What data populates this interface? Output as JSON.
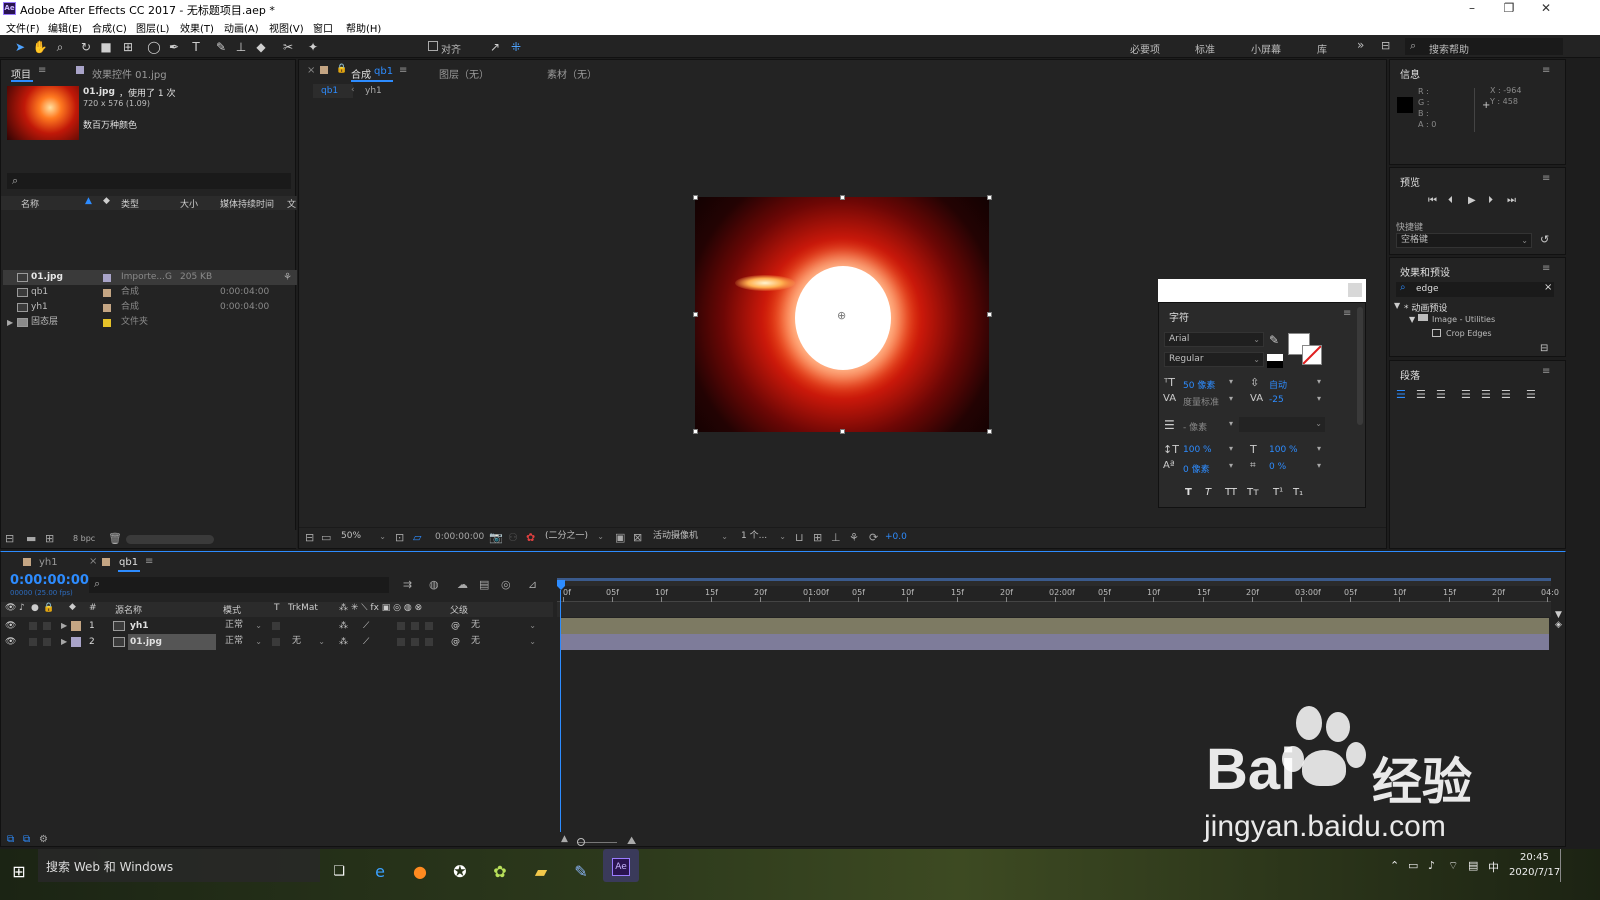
{
  "app": {
    "title": "Adobe After Effects CC 2017 - 无标题项目.aep *",
    "icon_label": "Ae",
    "window_controls": [
      "minimize-icon",
      "restore-icon",
      "close-icon"
    ]
  },
  "menu": [
    "文件(F)",
    "编辑(E)",
    "合成(C)",
    "图层(L)",
    "效果(T)",
    "动画(A)",
    "视图(V)",
    "窗口",
    "帮助(H)"
  ],
  "toolbar": {
    "tools": [
      "selection-tool-icon",
      "hand-tool-icon",
      "zoom-tool-icon",
      "rotate-tool-icon",
      "camera-tool-icon",
      "pan-behind-tool-icon",
      "ellipse-tool-icon",
      "pen-tool-icon",
      "type-tool-icon",
      "brush-tool-icon",
      "clone-stamp-tool-icon",
      "eraser-tool-icon",
      "roto-brush-tool-icon",
      "puppet-pin-tool-icon"
    ],
    "align_label": "对齐",
    "workspaces": [
      "必要项",
      "标准",
      "小屏幕",
      "库"
    ],
    "search_help_placeholder": "搜索帮助"
  },
  "project_panel": {
    "tab_project": "项目",
    "tab_effects": "效果控件 01.jpg",
    "thumb_name": "01.jpg",
    "thumb_usage": "，使用了 1 次",
    "thumb_dims": "720 x 576 (1.09)",
    "thumb_colors": "数百万种颜色",
    "columns": [
      "名称",
      "类型",
      "大小",
      "媒体持续时间",
      "文"
    ],
    "items": [
      {
        "name": "01.jpg",
        "type": "Importe...G",
        "size": "205 KB",
        "duration": "",
        "color": "#a9a4c9",
        "kind": "image"
      },
      {
        "name": "qb1",
        "type": "合成",
        "size": "",
        "duration": "0:00:04:00",
        "color": "#c4a583",
        "kind": "comp"
      },
      {
        "name": "yh1",
        "type": "合成",
        "size": "",
        "duration": "0:00:04:00",
        "color": "#c4a583",
        "kind": "comp"
      },
      {
        "name": "固态层",
        "type": "文件夹",
        "size": "",
        "duration": "",
        "color": "#e6c229",
        "kind": "folder"
      }
    ],
    "bpc": "8 bpc"
  },
  "composition_panel": {
    "tab_comp_prefix": "合成",
    "tab_comp_name": "qb1",
    "tab_layer": "图层（无）",
    "tab_footage": "素材（无）",
    "breadcrumbs": [
      "qb1",
      "yh1"
    ],
    "zoom": "50%",
    "timecode": "0:00:00:00",
    "resolution": "(二分之一)",
    "camera": "活动摄像机",
    "views": "1 个...",
    "exposure": "+0.0"
  },
  "character_panel": {
    "title": "字符",
    "font": "Arial",
    "style": "Regular",
    "size": "50 像素",
    "leading": "自动",
    "kerning": "度量标准",
    "tracking": "-25",
    "stroke_width": "- 像素",
    "vscale": "100 %",
    "hscale": "100 %",
    "baseline": "0 像素",
    "tsume": "0 %",
    "style_buttons": [
      "T",
      "T",
      "TT",
      "Tт",
      "T¹",
      "T₁"
    ]
  },
  "info_panel": {
    "title": "信息",
    "r": "R :",
    "g": "G :",
    "b": "B :",
    "a": "A : 0",
    "x": "X : -964",
    "y": "Y : 458"
  },
  "preview_panel": {
    "title": "预览",
    "shortcut_label": "快捷键",
    "shortcut_value": "空格键"
  },
  "effects_panel": {
    "title": "效果和预设",
    "search_value": "edge",
    "tree": [
      "* 动画预设",
      "Image - Utilities",
      "Crop Edges"
    ]
  },
  "paragraph_panel": {
    "title": "段落"
  },
  "timeline": {
    "tabs": [
      "yh1",
      "qb1"
    ],
    "timecode": "0:00:00:00",
    "fps": "00000 (25.00 fps)",
    "columns": [
      "#",
      "源名称",
      "模式",
      "T",
      "TrkMat",
      "父级"
    ],
    "layers": [
      {
        "num": "1",
        "name": "yh1",
        "mode": "正常",
        "trkmat": "",
        "parent": "无",
        "color": "#c4a583",
        "kind": "comp"
      },
      {
        "num": "2",
        "name": "01.jpg",
        "mode": "正常",
        "trkmat": "无",
        "parent": "无",
        "color": "#a9a4c9",
        "kind": "image"
      }
    ],
    "ruler": [
      "0f",
      "05f",
      "10f",
      "15f",
      "20f",
      "01:00f",
      "05f",
      "10f",
      "15f",
      "20f",
      "02:00f",
      "05f",
      "10f",
      "15f",
      "20f",
      "03:00f",
      "05f",
      "10f",
      "15f",
      "20f",
      "04:0"
    ]
  },
  "taskbar": {
    "search_placeholder": "搜索 Web 和 Windows",
    "time": "20:45",
    "date": "2020/7/17",
    "ime": "中"
  },
  "watermark": {
    "brand": "Bai",
    "brand2": "经验",
    "url": "jingyan.baidu.com"
  },
  "colors": {
    "accent": "#2d8cff",
    "panel_bg": "#232323",
    "bar_yh1": "#7d7a63",
    "bar_01": "#7e7c9a"
  }
}
